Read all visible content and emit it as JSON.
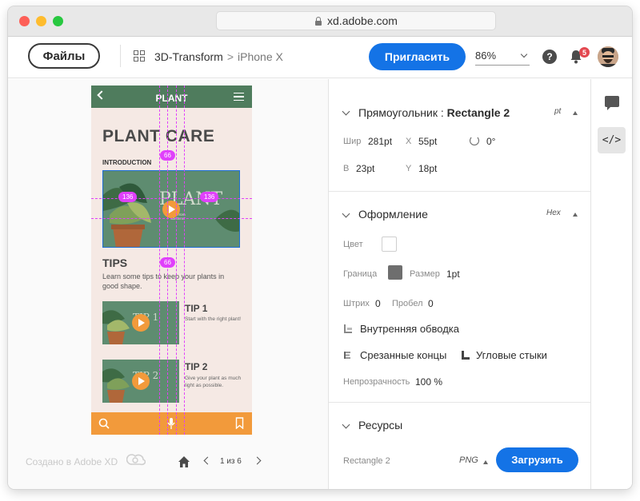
{
  "browser": {
    "url": "xd.adobe.com"
  },
  "header": {
    "files_label": "Файлы",
    "breadcrumb_project": "3D-Transform",
    "breadcrumb_sep": ">",
    "breadcrumb_artboard": "iPhone X",
    "invite_label": "Пригласить",
    "zoom": "86%",
    "help": "?",
    "notifications_count": "5",
    "accent": "#1473e6"
  },
  "phone": {
    "title": "PLANT",
    "heading": "PLANT CARE",
    "intro": "INTRODUCTION",
    "tips_title": "TIPS",
    "tips_desc": "Learn some tips to keep your plants in good shape.",
    "tip1_title": "TIP 1",
    "tip1_desc": "Start with the right plant!",
    "tip2_title": "TIP 2",
    "tip2_desc": "Give your plant as much light as possible.",
    "measure_top": "66",
    "measure_left": "136",
    "measure_right": "136",
    "measure_bottom": "66",
    "colors": {
      "green": "#4f7c5d",
      "orange": "#f29a3b",
      "bg": "#f5e9e4"
    }
  },
  "canvas_footer": {
    "made_with": "Создано в Adobe XD",
    "page": "1 из 6"
  },
  "inspect": {
    "rect_title_prefix": "Прямоугольник :",
    "rect_name": "Rectangle 2",
    "unit": "pt",
    "width_label": "Шир",
    "width_value": "281pt",
    "x_label": "X",
    "x_value": "55pt",
    "rotation_value": "0°",
    "height_label": "В",
    "height_value": "23pt",
    "y_label": "Y",
    "y_value": "18pt",
    "appearance_title": "Оформление",
    "color_mode": "Hex",
    "fill_label": "Цвет",
    "border_label": "Граница",
    "size_label": "Размер",
    "size_value": "1pt",
    "dash_label": "Штрих",
    "dash_value": "0",
    "gap_label": "Пробел",
    "gap_value": "0",
    "inner_stroke": "Внутренняя обводка",
    "butt_caps": "Срезанные концы",
    "miter_joins": "Угловые стыки",
    "opacity_label": "Непрозрачность",
    "opacity_value": "100 %",
    "assets_title": "Ресурсы",
    "asset_name": "Rectangle 2",
    "asset_format": "PNG",
    "download_label": "Загрузить"
  },
  "rail": {
    "code_label": "</>"
  }
}
